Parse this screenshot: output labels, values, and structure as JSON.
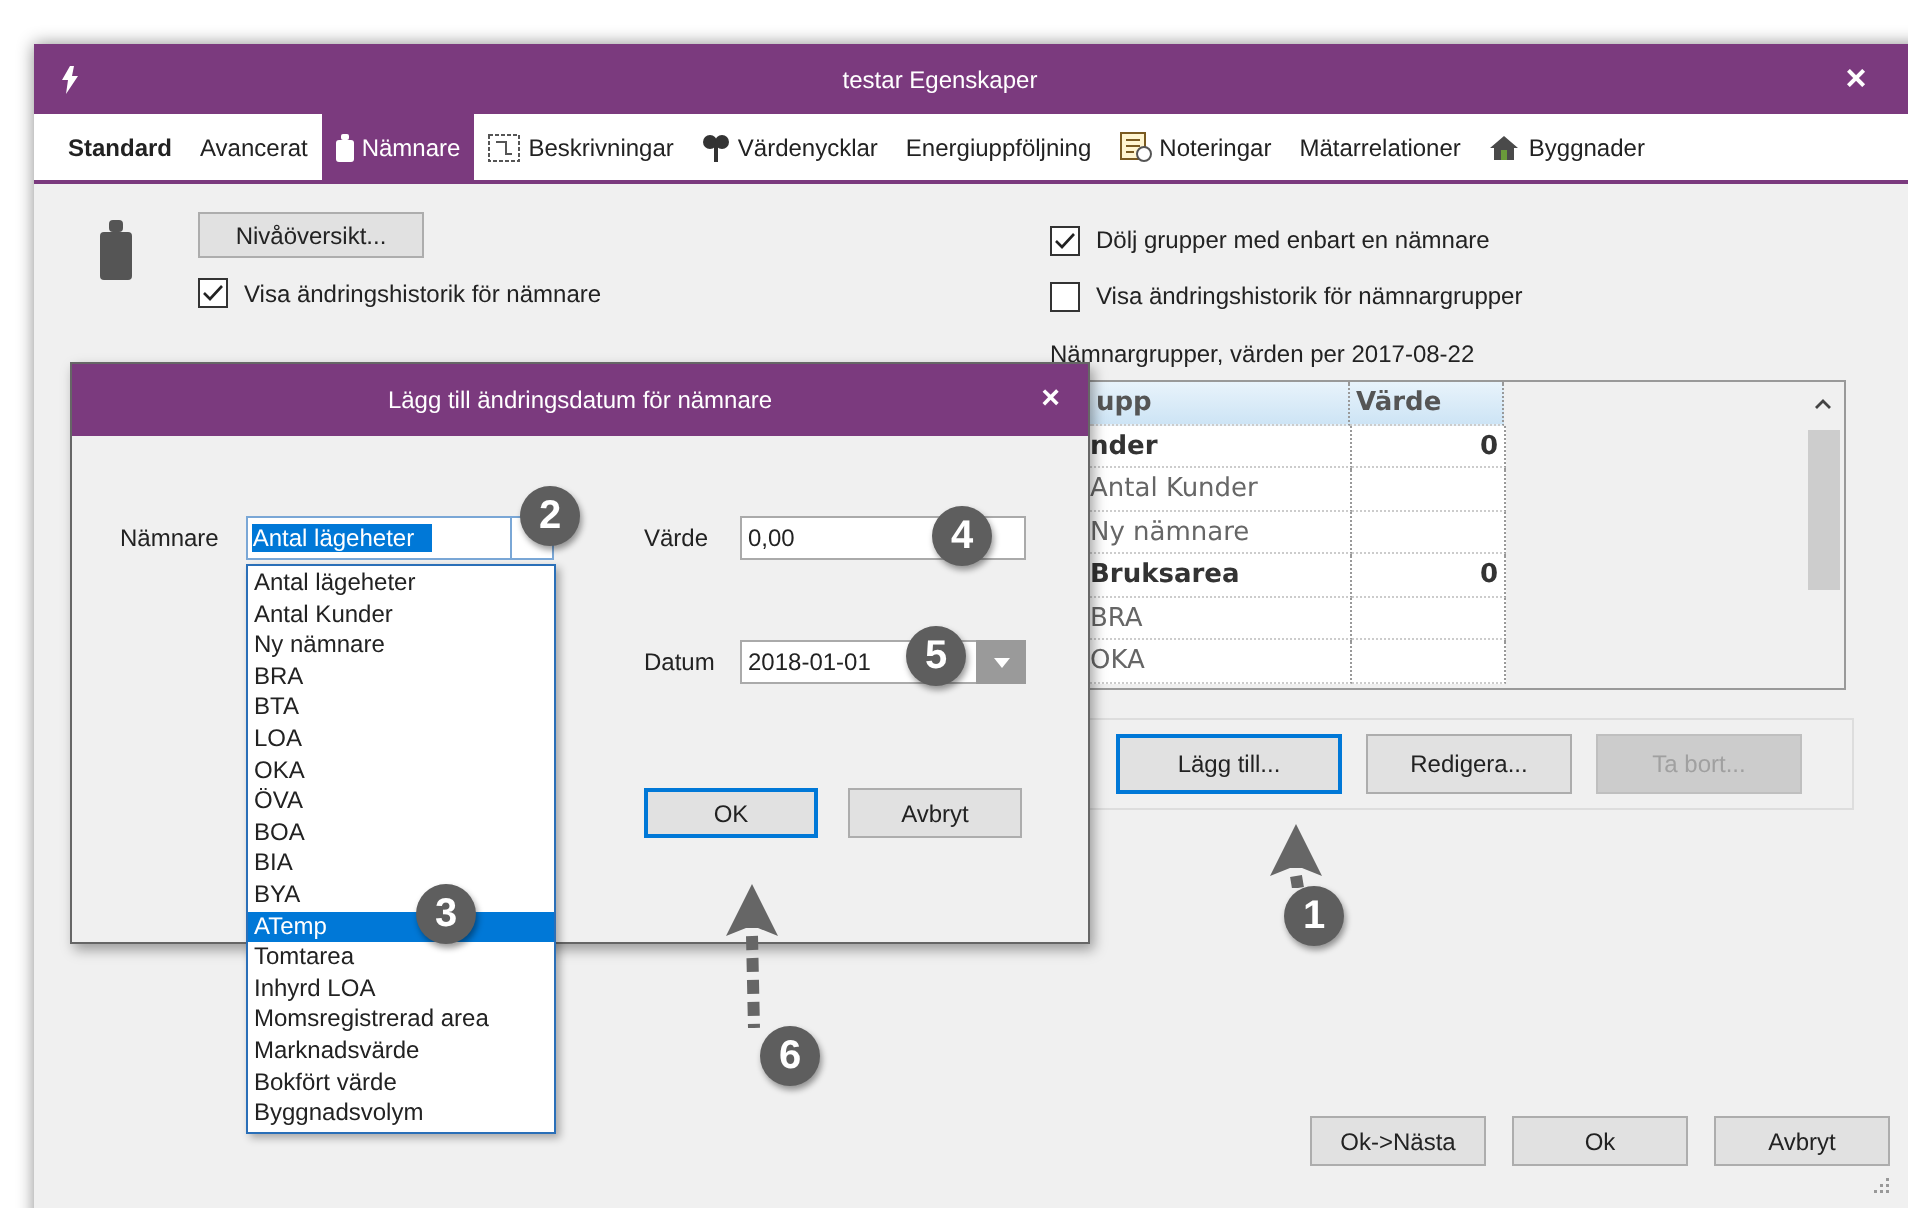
{
  "window": {
    "title": "testar Egenskaper",
    "close": "×"
  },
  "tabs": [
    {
      "label": "Standard",
      "selected": false,
      "bold": true
    },
    {
      "label": "Avancerat",
      "selected": false,
      "bold": false
    },
    {
      "label": "Nämnare",
      "selected": true,
      "bold": false
    },
    {
      "label": "Beskrivningar",
      "selected": false,
      "bold": false
    },
    {
      "label": "Värdenycklar",
      "selected": false,
      "bold": false
    },
    {
      "label": "Energiuppföljning",
      "selected": false,
      "bold": false
    },
    {
      "label": "Noteringar",
      "selected": false,
      "bold": false
    },
    {
      "label": "Mätarrelationer",
      "selected": false,
      "bold": false
    },
    {
      "label": "Byggnader",
      "selected": false,
      "bold": false
    }
  ],
  "left": {
    "button": "Nivåöversikt...",
    "checkbox": {
      "label": "Visa ändringshistorik för nämnare",
      "checked": true
    }
  },
  "right": {
    "checkboxes": [
      {
        "label": "Dölj grupper med enbart en nämnare",
        "checked": true
      },
      {
        "label": "Visa ändringshistorik för nämnargrupper",
        "checked": false
      }
    ],
    "table_label": "Nämnargrupper, värden per 2017-08-22",
    "table": {
      "columns": [
        "upp",
        "Värde"
      ],
      "groups": [
        {
          "name": "nder",
          "value": "0",
          "children": [
            {
              "name": "Antal Kunder"
            },
            {
              "name": "Ny nämnare"
            }
          ]
        },
        {
          "name": "Bruksarea",
          "value": "0",
          "children": [
            {
              "name": "BRA"
            },
            {
              "name": "OKA"
            }
          ]
        }
      ]
    },
    "buttons": [
      {
        "label": "Lägg till...",
        "focused": true,
        "disabled": false
      },
      {
        "label": "Redigera...",
        "focused": false,
        "disabled": false
      },
      {
        "label": "Ta bort...",
        "focused": false,
        "disabled": true
      }
    ]
  },
  "footer_buttons": [
    "Ok->Nästa",
    "Ok",
    "Avbryt"
  ],
  "dialog": {
    "title": "Lägg till ändringsdatum för nämnare",
    "close": "×",
    "namnare_label": "Nämnare",
    "namnare_value": "Antal lägeheter",
    "varde_label": "Värde",
    "varde_value": "0,00",
    "datum_label": "Datum",
    "datum_value": "2018-01-01",
    "buttons": [
      {
        "label": "OK",
        "focused": true
      },
      {
        "label": "Avbryt",
        "focused": false
      }
    ],
    "options": [
      {
        "label": "Antal lägeheter",
        "selected": false
      },
      {
        "label": "Antal Kunder",
        "selected": false
      },
      {
        "label": "Ny nämnare",
        "selected": false
      },
      {
        "label": "BRA",
        "selected": false
      },
      {
        "label": "BTA",
        "selected": false
      },
      {
        "label": "LOA",
        "selected": false
      },
      {
        "label": "OKA",
        "selected": false
      },
      {
        "label": "ÖVA",
        "selected": false
      },
      {
        "label": "BOA",
        "selected": false
      },
      {
        "label": "BIA",
        "selected": false
      },
      {
        "label": "BYA",
        "selected": false
      },
      {
        "label": "ATemp",
        "selected": true
      },
      {
        "label": "Tomtarea",
        "selected": false
      },
      {
        "label": "Inhyrd LOA",
        "selected": false
      },
      {
        "label": "Momsregistrerad area",
        "selected": false
      },
      {
        "label": "Marknadsvärde",
        "selected": false
      },
      {
        "label": "Bokfört värde",
        "selected": false
      },
      {
        "label": "Byggnadsvolym",
        "selected": false
      }
    ]
  },
  "callouts": [
    {
      "number": "1",
      "arrow": true
    },
    {
      "number": "2",
      "arrow": false
    },
    {
      "number": "3",
      "arrow": false
    },
    {
      "number": "4",
      "arrow": false
    },
    {
      "number": "5",
      "arrow": false
    },
    {
      "number": "6",
      "arrow": true
    }
  ]
}
